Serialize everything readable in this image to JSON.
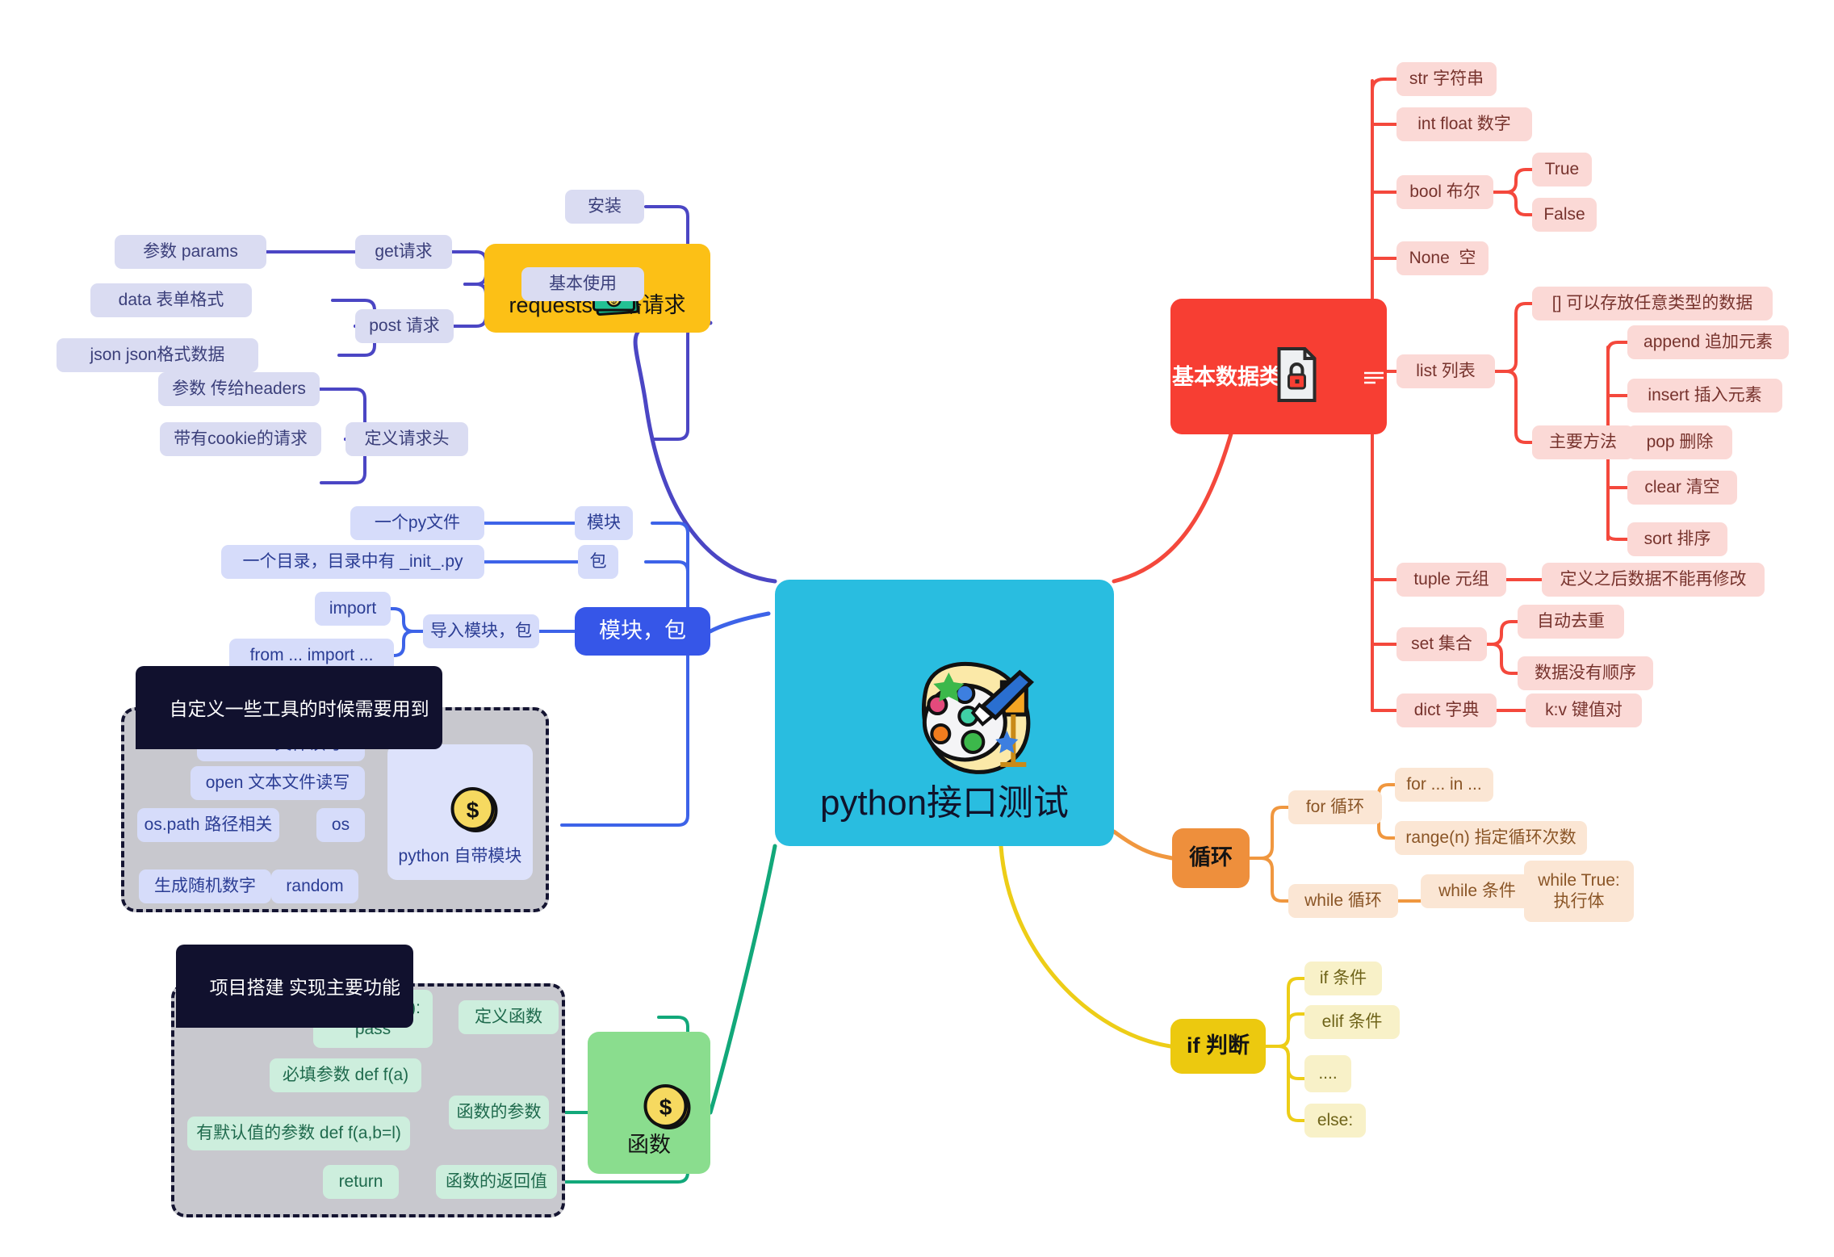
{
  "central": {
    "label": "python接口测试",
    "icon": "palette-brush-icon",
    "color": "#29bde0"
  },
  "branches": {
    "requests": {
      "label": "requests 网络请求",
      "icon": "money-banknote-icon",
      "color": "#fcc016",
      "link_color": "#4b46c4",
      "children": [
        {
          "label": "安装"
        },
        {
          "label": "基本使用",
          "children": [
            {
              "label": "get请求",
              "children": [
                {
                  "label": "参数 params"
                }
              ]
            },
            {
              "label": "post 请求",
              "children": [
                {
                  "label": "data 表单格式"
                },
                {
                  "label": "json json格式数据"
                }
              ]
            }
          ]
        },
        {
          "label": "定义请求头",
          "children": [
            {
              "label": "参数 传给headers"
            },
            {
              "label": "带有cookie的请求"
            }
          ]
        }
      ]
    },
    "modules": {
      "label": "模块，包",
      "color": "#3656e8",
      "link_color": "#3d63e8",
      "group_tab": "自定义一些工具的时候需要用到",
      "children": [
        {
          "label": "模块",
          "children": [
            {
              "label": "一个py文件"
            }
          ]
        },
        {
          "label": "包",
          "children": [
            {
              "label": "一个目录，目录中有 _init_.py"
            }
          ]
        },
        {
          "label": "导入模块，包",
          "children": [
            {
              "label": "import"
            },
            {
              "label": "from ... import ..."
            }
          ]
        },
        {
          "label": "python 自带模块",
          "icon": "gold-coin-icon",
          "children": [
            {
              "label": "csv csv文件读写"
            },
            {
              "label": "open 文本文件读写"
            },
            {
              "label": "os",
              "children": [
                {
                  "label": "os.path 路径相关"
                }
              ]
            },
            {
              "label": "random",
              "children": [
                {
                  "label": "生成随机数字"
                }
              ]
            }
          ]
        }
      ]
    },
    "functions": {
      "label": "函数",
      "icon": "gold-coin-icon",
      "color": "#8add8e",
      "link_color": "#12a87a",
      "group_tab": "项目搭建 实现主要功能",
      "children": [
        {
          "label": "定义函数",
          "children": [
            {
              "label": "def 函数名():\npass"
            }
          ]
        },
        {
          "label": "函数的参数",
          "children": [
            {
              "label": "必填参数 def f(a)"
            },
            {
              "label": "有默认值的参数 def f(a,b=l)"
            }
          ]
        },
        {
          "label": "函数的返回值",
          "children": [
            {
              "label": "return"
            }
          ]
        }
      ]
    },
    "datatypes": {
      "label": "基本数据类型",
      "icon": "document-lock-icon",
      "note_glyph": "note-lines-icon",
      "color": "#f73e33",
      "link_color": "#f4483c",
      "children": [
        {
          "label": "str 字符串"
        },
        {
          "label": "int float 数字"
        },
        {
          "label": "bool 布尔",
          "children": [
            {
              "label": "True"
            },
            {
              "label": "False"
            }
          ]
        },
        {
          "label": "None  空"
        },
        {
          "label": "list 列表",
          "children": [
            {
              "label": "[] 可以存放任意类型的数据"
            },
            {
              "label": "主要方法",
              "children": [
                {
                  "label": "append 追加元素"
                },
                {
                  "label": "insert 插入元素"
                },
                {
                  "label": "pop 删除"
                },
                {
                  "label": "clear 清空"
                },
                {
                  "label": "sort 排序"
                }
              ]
            }
          ]
        },
        {
          "label": "tuple 元组",
          "children": [
            {
              "label": "定义之后数据不能再修改"
            }
          ]
        },
        {
          "label": "set 集合",
          "children": [
            {
              "label": "自动去重"
            },
            {
              "label": "数据没有顺序"
            }
          ]
        },
        {
          "label": "dict 字典",
          "children": [
            {
              "label": "k:v 键值对"
            }
          ]
        }
      ]
    },
    "loops": {
      "label": "循环",
      "color": "#ee8f3c",
      "link_color": "#f0973f",
      "children": [
        {
          "label": "for 循环",
          "children": [
            {
              "label": "for ... in ..."
            },
            {
              "label": "range(n) 指定循环次数"
            }
          ]
        },
        {
          "label": "while 循环",
          "children": [
            {
              "label": "while 条件",
              "children": [
                {
                  "label": "while True:\n执行体"
                }
              ]
            }
          ]
        }
      ]
    },
    "conditionals": {
      "label": "if 判断",
      "color": "#ecc90f",
      "link_color": "#edcd17",
      "children": [
        {
          "label": "if 条件"
        },
        {
          "label": "elif 条件"
        },
        {
          "label": "...."
        },
        {
          "label": "else:"
        }
      ]
    }
  }
}
